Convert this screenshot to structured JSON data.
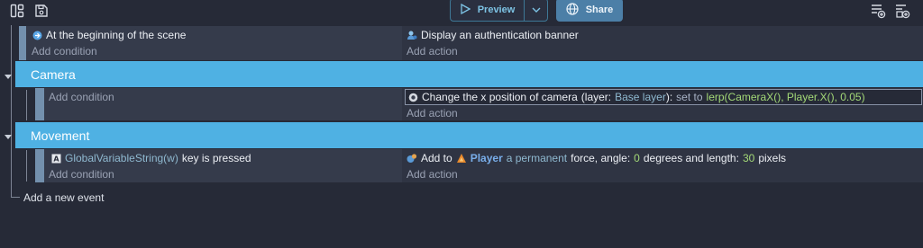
{
  "toolbar": {
    "preview_label": "Preview",
    "share_label": "Share"
  },
  "events": {
    "scene_start": {
      "condition": "At the beginning of the scene",
      "add_condition": "Add condition",
      "action": "Display an authentication banner",
      "add_action": "Add action"
    },
    "camera_group": {
      "title": "Camera",
      "add_condition": "Add condition",
      "action": {
        "text": "Change the x position of camera",
        "paren_open": "(layer:",
        "layer": "Base layer",
        "paren_close": "):",
        "set_to": "set to",
        "expression": "lerp(CameraX(), Player.X(), 0.05)"
      },
      "add_action": "Add action"
    },
    "movement_group": {
      "title": "Movement",
      "condition": {
        "param": "GlobalVariableString(w)",
        "text": "key is pressed"
      },
      "add_condition": "Add condition",
      "action": {
        "add_to": "Add to",
        "object": "Player",
        "force_type": "a permanent",
        "force_label": "force, angle:",
        "angle": "0",
        "degrees_label": "degrees and length:",
        "length": "30",
        "pixels_label": "pixels"
      },
      "add_action": "Add action"
    },
    "add_event": "Add a new event"
  },
  "colors": {
    "background": "#262a37",
    "group_bar": "#4fb1e3",
    "accent_number": "#a3d977",
    "accent_param": "#8fb9d0",
    "object_name": "#79aeea"
  },
  "icons": [
    "layout-icon",
    "save-icon",
    "play-icon",
    "chevron-down-icon",
    "globe-icon",
    "add-event-icon",
    "add-condition-icon",
    "scene-start-icon",
    "auth-banner-icon",
    "camera-icon",
    "keyboard-icon",
    "physics-icon",
    "player-icon"
  ]
}
